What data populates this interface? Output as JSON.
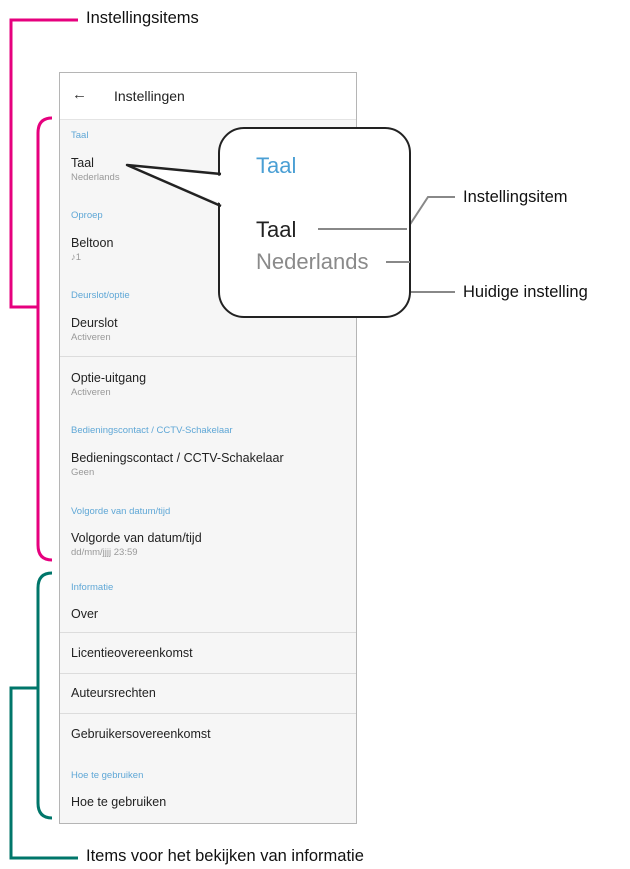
{
  "annotations": {
    "top": "Instellingsitems",
    "bottom": "Items voor het bekijken van informatie",
    "setting_item": "Instellingsitem",
    "current_setting": "Huidige instelling"
  },
  "screen": {
    "back_glyph": "←",
    "title": "Instellingen"
  },
  "sections": {
    "taal": "Taal",
    "oproep": "Oproep",
    "deurslot": "Deurslot/optie",
    "bediening": "Bedieningscontact / CCTV-Schakelaar",
    "datum": "Volgorde van datum/tijd",
    "informatie": "Informatie",
    "hoe": "Hoe te gebruiken"
  },
  "items": {
    "taal": {
      "label": "Taal",
      "value": "Nederlands"
    },
    "beltoon": {
      "label": "Beltoon",
      "value": "♪1"
    },
    "deurslot": {
      "label": "Deurslot",
      "value": "Activeren"
    },
    "optie": {
      "label": "Optie-uitgang",
      "value": "Activeren"
    },
    "bediening": {
      "label": "Bedieningscontact / CCTV-Schakelaar",
      "value": "Geen"
    },
    "datum": {
      "label": "Volgorde van datum/tijd",
      "value": "dd/mm/jjjj 23:59"
    },
    "over": {
      "label": "Over"
    },
    "licentie": {
      "label": "Licentieovereenkomst"
    },
    "auteurs": {
      "label": "Auteursrechten"
    },
    "gebruikers": {
      "label": "Gebruikersovereenkomst"
    },
    "hoe": {
      "label": "Hoe te gebruiken"
    }
  },
  "callout": {
    "section": "Taal",
    "label": "Taal",
    "value": "Nederlands"
  },
  "colors": {
    "magenta_bracket": "#e6007e",
    "teal_bracket": "#00766a",
    "section_blue": "#5fa7d6"
  }
}
